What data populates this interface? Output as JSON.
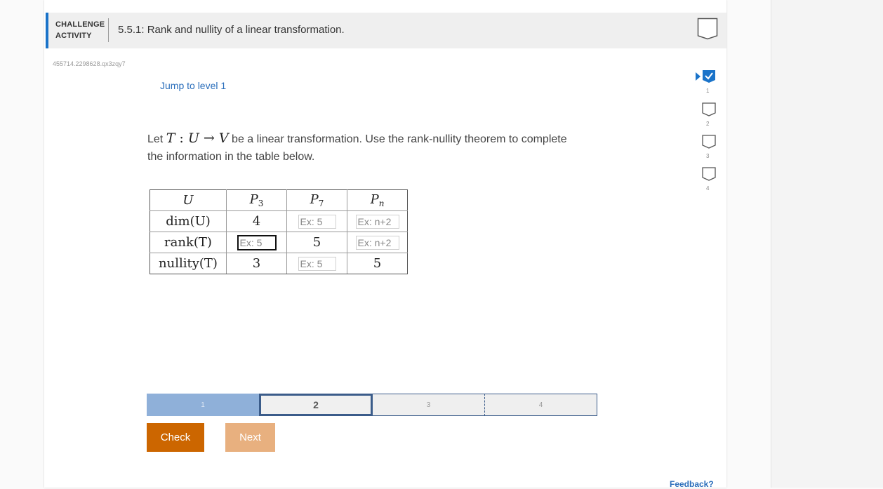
{
  "header": {
    "label_line1": "CHALLENGE",
    "label_line2": "ACTIVITY",
    "title": "5.5.1: Rank and nullity of a linear transformation."
  },
  "activity_id": "455714.2298628.qx3zqy7",
  "jump_link": "Jump to level 1",
  "prompt": {
    "before": "Let ",
    "math_T": "T",
    "colon": " : ",
    "math_U": "U",
    "arrow": " → ",
    "math_V": "V",
    "after": " be a linear transformation. Use the rank-nullity theorem to complete the information in the table below."
  },
  "table": {
    "header": {
      "row_label": "U",
      "col1_letter": "P",
      "col1_sub": "3",
      "col2_letter": "P",
      "col2_sub": "7",
      "col3_letter": "P",
      "col3_sub": "n"
    },
    "row_labels": {
      "dim": "dim(U)",
      "rank": "rank(T)",
      "nullity": "nullity(T)"
    },
    "dim": {
      "p3": "4",
      "p7_placeholder": "Ex: 5",
      "pn_placeholder": "Ex: n+2"
    },
    "rank": {
      "p3_placeholder": "Ex: 5",
      "p7": "5",
      "pn_placeholder": "Ex: n+2"
    },
    "nullity": {
      "p3": "3",
      "p7_placeholder": "Ex: 5",
      "pn": "5"
    }
  },
  "progress": {
    "levels": [
      "1",
      "2",
      "3",
      "4"
    ],
    "current": "2"
  },
  "buttons": {
    "check": "Check",
    "next": "Next"
  },
  "side_levels": [
    "1",
    "2",
    "3",
    "4"
  ],
  "feedback": "Feedback?",
  "colors": {
    "accent": "#1a73c9",
    "check": "#cc6600",
    "next": "#e8b07f",
    "progress_done": "#8fb0d9"
  }
}
